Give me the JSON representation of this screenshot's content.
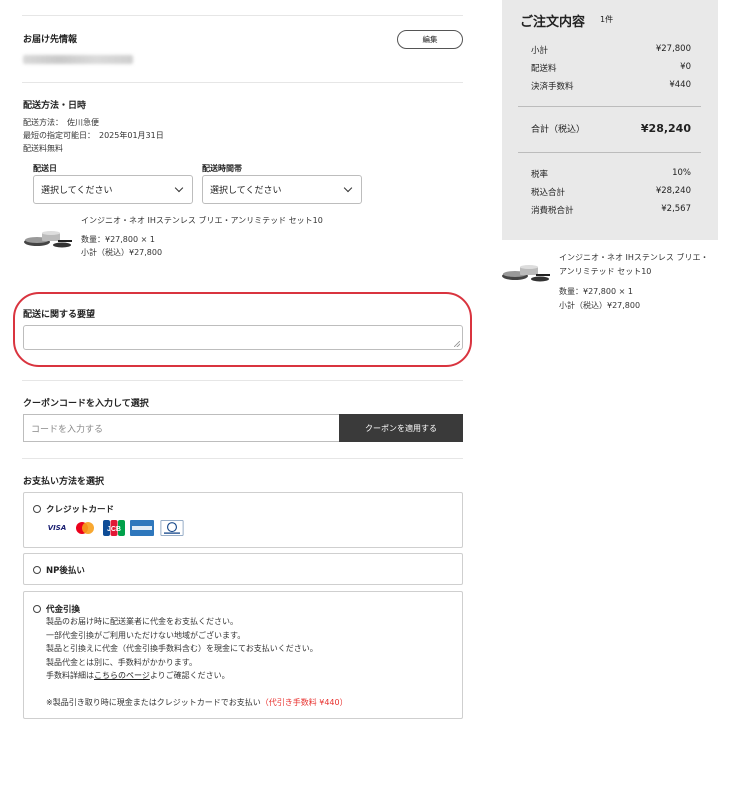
{
  "shipping_address": {
    "title": "お届け先情報",
    "edit_label": "編集"
  },
  "delivery": {
    "title": "配送方法・日時",
    "method_line": "配送方法：　佐川急便",
    "earliest_line": "最短の指定可能日：　2025年01月31日",
    "fee_line": "配送料無料",
    "date_label": "配送日",
    "date_value": "選択してください",
    "time_label": "配送時間帯",
    "time_value": "選択してください"
  },
  "product": {
    "name": "インジニオ・ネオ IHステンレス ブリエ・アンリミテッド セット10",
    "qty_line": "数量：¥27,800 × 1",
    "subtotal_line": "小計（税込）¥27,800",
    "summary_name_line1": "インジニオ・ネオ IHステンレス ブリエ・",
    "summary_name_line2": "アンリミテッド セット10",
    "summary_qty_line": "数量：¥27,800 × 1",
    "summary_subtotal_line": "小計（税込）¥27,800"
  },
  "delivery_request": {
    "title": "配送に関する要望",
    "value": ""
  },
  "coupon": {
    "title": "クーポンコードを入力して選択",
    "placeholder": "コードを入力する",
    "button_label": "クーポンを適用する"
  },
  "payment": {
    "title": "お支払い方法を選択",
    "options": [
      {
        "label": "クレジットカード"
      },
      {
        "label": "NP後払い"
      },
      {
        "label": "代金引換"
      }
    ],
    "cards": [
      "VISA",
      "Mastercard",
      "JCB",
      "AMERICAN EXPRESS",
      "Diners Club"
    ],
    "cod_lines": [
      "製品のお届け時に配送業者に代金をお支払ください。",
      "一部代金引換がご利用いただけない地域がございます。",
      "製品と引換えに代金（代金引換手数料含む）を現金にてお支払いください。",
      "製品代金とは別に、手数料がかかります。"
    ],
    "cod_detail_prefix": "手数料詳細は",
    "cod_detail_link": "こちらのページ",
    "cod_detail_suffix": "よりご確認ください。",
    "cod_note": "※製品引き取り時に現金またはクレジットカードでお支払い",
    "cod_fee": "（代引き手数料 ¥440）"
  },
  "summary": {
    "title": "ご注文内容",
    "count": "1件",
    "rows": [
      {
        "label": "小計",
        "value": "¥27,800"
      },
      {
        "label": "配送料",
        "value": "¥0"
      },
      {
        "label": "決済手数料",
        "value": "¥440"
      }
    ],
    "total_label": "合計（税込）",
    "total_value": "¥28,240",
    "tax_rows": [
      {
        "label": "税率",
        "value": "10%"
      },
      {
        "label": "税込合計",
        "value": "¥28,240"
      },
      {
        "label": "消費税合計",
        "value": "¥2,567"
      }
    ]
  },
  "colors": {
    "accent_red": "#e8322f",
    "highlight_outline": "#d9343f",
    "button_dark": "#3a3a3a",
    "summary_bg": "#e9e9e9"
  }
}
